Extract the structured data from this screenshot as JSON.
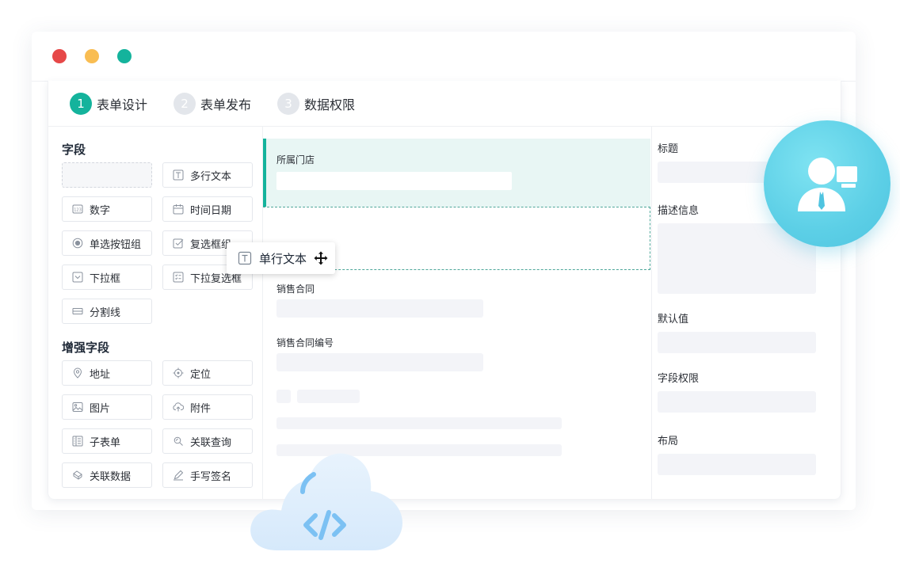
{
  "steps": [
    {
      "num": "1",
      "label": "表单设计"
    },
    {
      "num": "2",
      "label": "表单发布"
    },
    {
      "num": "3",
      "label": "数据权限"
    }
  ],
  "fields": {
    "title": "字段",
    "items": [
      {
        "label": ""
      },
      {
        "label": "多行文本",
        "icon": "multiline-text-icon"
      },
      {
        "label": "数字",
        "icon": "number-icon"
      },
      {
        "label": "时间日期",
        "icon": "calendar-icon"
      },
      {
        "label": "单选按钮组",
        "icon": "radio-icon"
      },
      {
        "label": "复选框组",
        "icon": "checkbox-icon"
      },
      {
        "label": "下拉框",
        "icon": "dropdown-icon"
      },
      {
        "label": "下拉复选框",
        "icon": "dropdown-checklist-icon"
      },
      {
        "label": "分割线",
        "icon": "divider-icon"
      }
    ]
  },
  "enhanced": {
    "title": "增强字段",
    "items": [
      {
        "label": "地址",
        "icon": "location-pin-icon"
      },
      {
        "label": "定位",
        "icon": "crosshair-icon"
      },
      {
        "label": "图片",
        "icon": "image-icon"
      },
      {
        "label": "附件",
        "icon": "upload-cloud-icon"
      },
      {
        "label": "子表单",
        "icon": "subform-icon"
      },
      {
        "label": "关联查询",
        "icon": "link-query-icon"
      },
      {
        "label": "关联数据",
        "icon": "link-data-icon"
      },
      {
        "label": "手写签名",
        "icon": "pen-icon"
      }
    ]
  },
  "drag_chip": {
    "label": "单行文本",
    "icon": "text-field-icon"
  },
  "canvas": {
    "field1_label": "所属门店",
    "field2_label": "销售合同",
    "field3_label": "销售合同编号"
  },
  "properties": {
    "labels": [
      "标题",
      "描述信息",
      "默认值",
      "字段权限",
      "布局"
    ]
  },
  "colors": {
    "accent": "#14b39c",
    "dot_red": "#e64848",
    "dot_yellow": "#f9bd52",
    "dot_green": "#14b39c"
  }
}
